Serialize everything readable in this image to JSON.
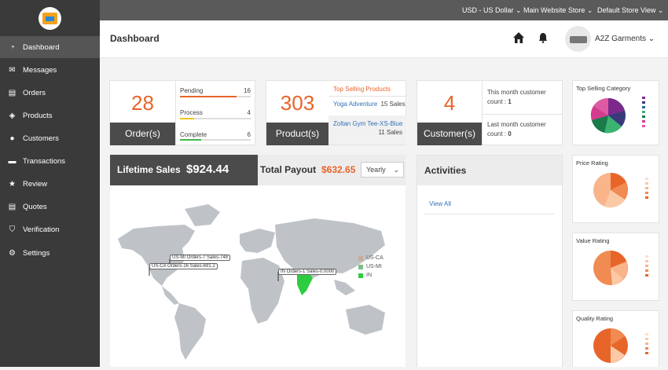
{
  "topbar": {
    "currency": "USD - US Dollar",
    "store": "Main Website Store",
    "view": "Default Store View"
  },
  "sidebar": {
    "items": [
      {
        "label": "Dashboard",
        "icon": "dashboard-icon"
      },
      {
        "label": "Messages",
        "icon": "envelope-icon"
      },
      {
        "label": "Orders",
        "icon": "list-icon"
      },
      {
        "label": "Products",
        "icon": "box-icon"
      },
      {
        "label": "Customers",
        "icon": "user-icon"
      },
      {
        "label": "Transactions",
        "icon": "card-icon"
      },
      {
        "label": "Review",
        "icon": "star-icon"
      },
      {
        "label": "Quotes",
        "icon": "list-icon"
      },
      {
        "label": "Verification",
        "icon": "shield-icon"
      },
      {
        "label": "Settings",
        "icon": "gear-icon"
      }
    ]
  },
  "header": {
    "title": "Dashboard",
    "account": "A2Z Garments"
  },
  "orders": {
    "count": "28",
    "label": "Order(s)",
    "rows": [
      {
        "name": "Pending",
        "value": "16",
        "color": "#e8652a",
        "fraction": 0.8
      },
      {
        "name": "Process",
        "value": "4",
        "color": "#f0c419",
        "fraction": 0.2
      },
      {
        "name": "Complete",
        "value": "6",
        "color": "#3fb54a",
        "fraction": 0.3
      }
    ]
  },
  "products": {
    "count": "303",
    "label": "Product(s)",
    "top_title": "Top Selling Products",
    "items": [
      {
        "name": "Yoga Adventure",
        "sales": "15 Sales"
      },
      {
        "name": "Zoltan Gym Tee-XS-Blue",
        "sales": "11 Sales"
      }
    ]
  },
  "customers": {
    "count": "4",
    "label": "Customer(s)",
    "this_month_label": "This month customer count :",
    "this_month_value": "1",
    "last_month_label": "Last month customer count :",
    "last_month_value": "0"
  },
  "sales": {
    "lifetime_label": "Lifetime Sales",
    "lifetime_value": "$924.44",
    "payout_label": "Total Payout",
    "payout_value": "$632.65",
    "period": "Yearly"
  },
  "map": {
    "tooltips": [
      "US-MI Orders-7 Sales-748",
      "US-CA Orders-16 Sales-691.2",
      "IN Orders-1 Sales-0.0000"
    ],
    "legend": [
      {
        "name": "US-CA",
        "color": "#c8ad9c"
      },
      {
        "name": "US-MI",
        "color": "#7fbf8a"
      },
      {
        "name": "IN",
        "color": "#2ecc40"
      }
    ]
  },
  "activities": {
    "title": "Activities",
    "view_all": "View All"
  },
  "right_charts": {
    "category_title": "Top Selling Category",
    "price_title": "Price Rating",
    "value_title": "Value Rating",
    "quality_title": "Quality Rating"
  },
  "colors": {
    "accent": "#e8652a",
    "link": "#2f73b8",
    "dark": "#4b4b4b"
  }
}
